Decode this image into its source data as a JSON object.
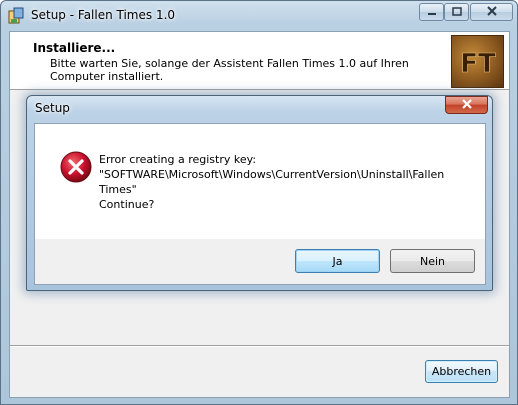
{
  "setup_window": {
    "title": "Setup - Fallen Times 1.0",
    "header_title": "Installiere...",
    "header_description": "Bitte warten Sie, solange der Assistent Fallen Times 1.0 auf Ihren Computer installiert.",
    "logo_text": "FT",
    "abort_button_label": "Abbrechen",
    "icons": {
      "app": "setup-app-icon",
      "minimize": "minimize-icon",
      "maximize": "maximize-icon",
      "close": "close-icon"
    }
  },
  "error_dialog": {
    "title": "Setup",
    "message_lines": [
      "Error creating a registry key:",
      "\"SOFTWARE\\Microsoft\\Windows\\CurrentVersion\\Uninstall\\Fallen",
      "Times\"",
      "Continue?"
    ],
    "yes_label": "Ja",
    "no_label": "Nein",
    "icons": {
      "error": "error-icon",
      "close": "close-icon"
    }
  },
  "colors": {
    "error_red": "#c8102e",
    "default_button_border": "#3c7fb1",
    "dialog_close_red": "#c2412a"
  }
}
